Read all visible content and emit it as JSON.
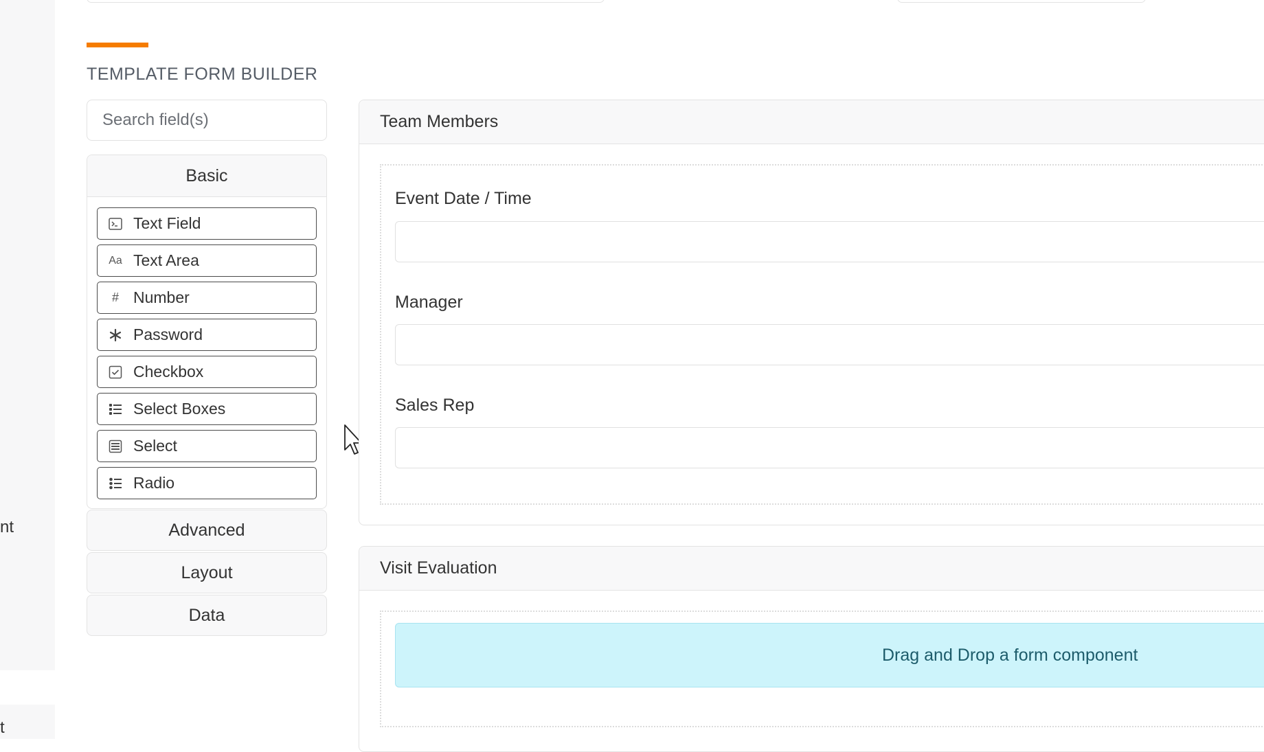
{
  "left_strip": {
    "text_fragment_1": "nt",
    "text_fragment_2": "t"
  },
  "builder": {
    "title": "TEMPLATE FORM BUILDER",
    "accent_color": "#f57c00",
    "search": {
      "placeholder": "Search field(s)",
      "value": ""
    },
    "groups": {
      "basic": {
        "label": "Basic",
        "components": [
          {
            "label": "Text Field",
            "icon": "terminal-icon"
          },
          {
            "label": "Text Area",
            "icon": "font-aa-icon"
          },
          {
            "label": "Number",
            "icon": "hash-icon"
          },
          {
            "label": "Password",
            "icon": "asterisk-icon"
          },
          {
            "label": "Checkbox",
            "icon": "check-square-icon"
          },
          {
            "label": "Select Boxes",
            "icon": "list-check-icon"
          },
          {
            "label": "Select",
            "icon": "th-list-icon"
          },
          {
            "label": "Radio",
            "icon": "list-ul-icon"
          }
        ]
      },
      "advanced": {
        "label": "Advanced"
      },
      "layout": {
        "label": "Layout"
      },
      "data": {
        "label": "Data"
      }
    }
  },
  "canvas": {
    "panels": [
      {
        "title": "Team Members",
        "fields": [
          {
            "label": "Event Date / Time",
            "value": ""
          },
          {
            "label": "Manager",
            "value": ""
          },
          {
            "label": "Sales Rep",
            "value": ""
          }
        ]
      },
      {
        "title": "Visit Evaluation",
        "drop_hint": "Drag and Drop a form component",
        "drop_hint_color": "#cdf4fb"
      }
    ]
  }
}
